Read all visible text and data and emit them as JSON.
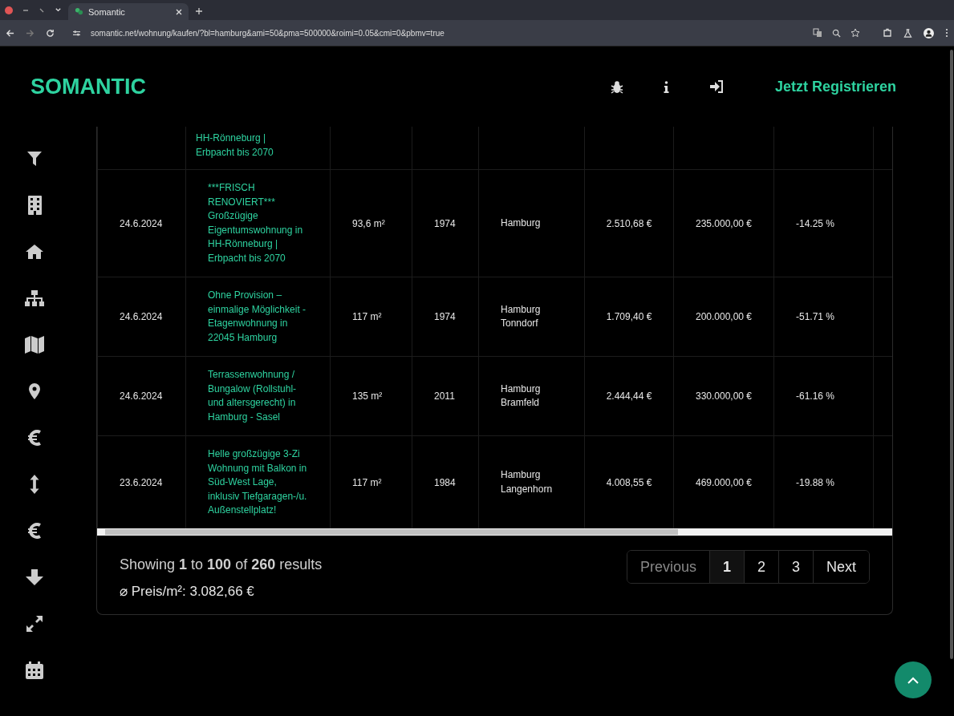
{
  "browser": {
    "tab_title": "Somantic",
    "url": "somantic.net/wohnung/kaufen/?bl=hamburg&ami=50&pma=500000&roimi=0.05&cmi=0&pbmv=true"
  },
  "header": {
    "logo": "SOMANTIC",
    "register": "Jetzt Registrieren"
  },
  "table": {
    "partial_row": {
      "title_lines": [
        "HH-Rönneburg |",
        "Erbpacht bis 2070"
      ]
    },
    "rows": [
      {
        "date": "24.6.2024",
        "title": "***FRISCH RENOVIERT*** Großzügige Eigentumswohnung in HH-Rönneburg | Erbpacht bis 2070",
        "area": "93,6 m²",
        "year": "1974",
        "location": "Hamburg",
        "price_m2": "2.510,68 €",
        "price": "235.000,00 €",
        "roi": "-14.25 %"
      },
      {
        "date": "24.6.2024",
        "title": "Ohne Provision – einmalige Möglichkeit - Etagenwohnung in 22045 Hamburg",
        "area": "117 m²",
        "year": "1974",
        "location": "Hamburg Tonndorf",
        "price_m2": "1.709,40 €",
        "price": "200.000,00 €",
        "roi": "-51.71 %"
      },
      {
        "date": "24.6.2024",
        "title": "Terrassenwohnung / Bungalow (Rollstuhl- und altersgerecht) in Hamburg - Sasel",
        "area": "135 m²",
        "year": "2011",
        "location": "Hamburg Bramfeld",
        "price_m2": "2.444,44 €",
        "price": "330.000,00 €",
        "roi": "-61.16 %"
      },
      {
        "date": "23.6.2024",
        "title": "Helle großzügige 3-Zi Wohnung mit Balkon in Süd-West Lage, inklusiv Tiefgaragen-/u. Außenstellplatz!",
        "area": "117 m²",
        "year": "1984",
        "location": "Hamburg Langenhorn",
        "price_m2": "4.008,55 €",
        "price": "469.000,00 €",
        "roi": "-19.88 %"
      }
    ]
  },
  "footer": {
    "summary": "Showing **1** to **100** of **260** results",
    "average": "⌀ Preis/m²: 3.082,66 €",
    "pagination": [
      {
        "label": "Previous",
        "selected": false,
        "disabled": true
      },
      {
        "label": "1",
        "selected": true,
        "disabled": false
      },
      {
        "label": "2",
        "selected": false,
        "disabled": false
      },
      {
        "label": "3",
        "selected": false,
        "disabled": false
      },
      {
        "label": "Next",
        "selected": false,
        "disabled": false
      }
    ]
  }
}
